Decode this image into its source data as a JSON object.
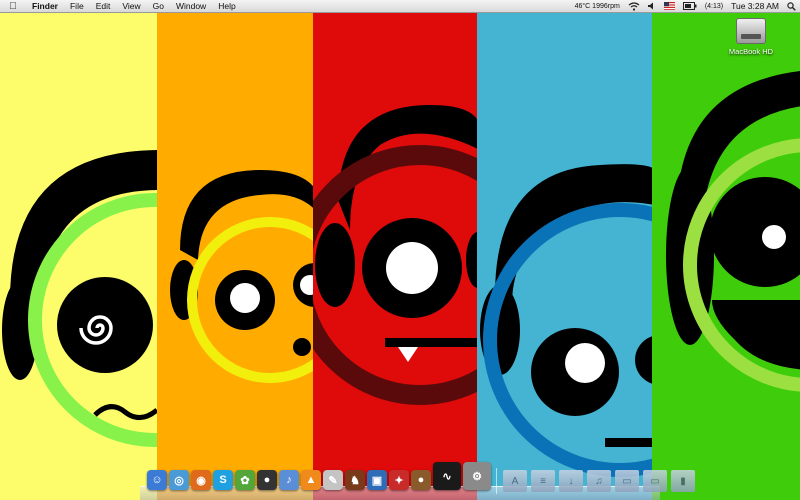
{
  "menubar": {
    "apple_icon": "apple-logo-icon",
    "app_name": "Finder",
    "menus": [
      "File",
      "Edit",
      "View",
      "Go",
      "Window",
      "Help"
    ],
    "status": {
      "temp_fan": "46°C 1996rpm",
      "battery_time": "(4:13)",
      "clock": "Tue 3:28 AM"
    }
  },
  "desktop": {
    "icons": [
      {
        "label": "MacBook HD",
        "icon": "hard-drive-icon"
      }
    ]
  },
  "dock": {
    "apps": [
      {
        "name": "finder",
        "icon": "finder-icon",
        "color": "#3b7bd6",
        "glyph": "☺"
      },
      {
        "name": "safari",
        "icon": "safari-icon",
        "color": "#4a9ad8",
        "glyph": "◎"
      },
      {
        "name": "firefox",
        "icon": "firefox-icon",
        "color": "#e06a1b",
        "glyph": "◉"
      },
      {
        "name": "skype",
        "icon": "skype-icon",
        "color": "#1fa0e0",
        "glyph": "S"
      },
      {
        "name": "adium",
        "icon": "adium-icon",
        "color": "#52a63a",
        "glyph": "✿"
      },
      {
        "name": "facetime",
        "icon": "webcam-icon",
        "color": "#333333",
        "glyph": "●"
      },
      {
        "name": "itunes",
        "icon": "itunes-icon",
        "color": "#5a8fd8",
        "glyph": "♪"
      },
      {
        "name": "vlc",
        "icon": "vlc-cone-icon",
        "color": "#f08a1c",
        "glyph": "▲"
      },
      {
        "name": "preview",
        "icon": "preview-icon",
        "color": "#c4c4c4",
        "glyph": "✎"
      },
      {
        "name": "game",
        "icon": "game-icon",
        "color": "#7a3a1a",
        "glyph": "♞"
      },
      {
        "name": "iphoto",
        "icon": "iphoto-icon",
        "color": "#2f6cb8",
        "glyph": "▣"
      },
      {
        "name": "joystick",
        "icon": "joystick-icon",
        "color": "#c92a2a",
        "glyph": "✦"
      },
      {
        "name": "coffee",
        "icon": "coffee-icon",
        "color": "#8a5a2a",
        "glyph": "●"
      },
      {
        "name": "activity",
        "icon": "activity-monitor-icon",
        "color": "#1a1a1a",
        "glyph": "∿"
      },
      {
        "name": "settings",
        "icon": "system-preferences-icon",
        "color": "#8a8a8a",
        "glyph": "⚙"
      }
    ],
    "folders": [
      {
        "name": "applications",
        "icon": "applications-folder-icon",
        "glyph": "A"
      },
      {
        "name": "documents",
        "icon": "documents-folder-icon",
        "glyph": "≡"
      },
      {
        "name": "downloads",
        "icon": "downloads-folder-icon",
        "glyph": "↓"
      },
      {
        "name": "music",
        "icon": "music-folder-icon",
        "glyph": "♫"
      },
      {
        "name": "pictures",
        "icon": "pictures-folder-icon",
        "glyph": "▭"
      },
      {
        "name": "movies",
        "icon": "movies-folder-icon",
        "glyph": "▭"
      },
      {
        "name": "trash",
        "icon": "trash-icon",
        "glyph": "▮"
      }
    ]
  },
  "wallpaper": {
    "panels": [
      {
        "name": "yellow-panel",
        "color": "#fdfd6b"
      },
      {
        "name": "orange-panel",
        "color": "#ffab00"
      },
      {
        "name": "red-panel",
        "color": "#df0a0a"
      },
      {
        "name": "blue-panel",
        "color": "#45b4d2"
      },
      {
        "name": "green-panel",
        "color": "#3fcc0a"
      }
    ]
  }
}
